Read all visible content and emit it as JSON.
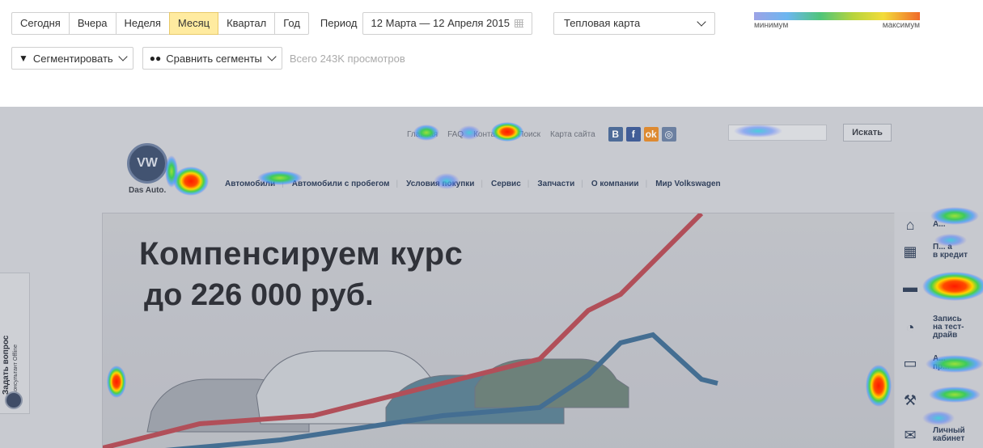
{
  "toolbar": {
    "periods": [
      "Сегодня",
      "Вчера",
      "Неделя",
      "Месяц",
      "Квартал",
      "Год"
    ],
    "active_period": "Месяц",
    "period_label": "Период",
    "date_range": "12 Марта — 12 Апреля 2015",
    "map_type": "Тепловая карта",
    "legend": {
      "min_label": "минимум",
      "max_label": "максимум"
    },
    "segment_label": "Сегментировать",
    "compare_label": "Сравнить сегменты",
    "views_total": "Всего 243K просмотров"
  },
  "site": {
    "top_links": [
      "Главная",
      "FAQ",
      "Контакты",
      "Поиск",
      "Карта сайта"
    ],
    "social": [
      {
        "glyph": "В",
        "color": "#4a6a9a"
      },
      {
        "glyph": "f",
        "color": "#3c5a98"
      },
      {
        "glyph": "ok",
        "color": "#e78a2a"
      },
      {
        "glyph": "◎",
        "color": "#6b7fa3"
      }
    ],
    "search_button": "Искать",
    "brand_caption": "Das Auto.",
    "nav": [
      "Автомобили",
      "Автомобили с пробегом",
      "Условия покупки",
      "Сервис",
      "Запчасти",
      "О компании",
      "Мир Volkswagen"
    ],
    "headline": "Компенсируем курс",
    "subline": "до 226 000 руб.",
    "side_tab": {
      "title": "Задать вопрос",
      "subtitle": "Консультант Offline"
    },
    "right_menu": [
      {
        "icon": "home-icon",
        "glyph": "⌂",
        "label": "А..."
      },
      {
        "icon": "calculator-icon",
        "glyph": "▦",
        "label": "П... а\nв кредит"
      },
      {
        "icon": "car-icon",
        "glyph": "▬",
        "label": ""
      },
      {
        "icon": "speedometer-icon",
        "glyph": "◔",
        "label": "Запись\nна тест-драйв"
      },
      {
        "icon": "car-outline-icon",
        "glyph": "▭",
        "label": "А...\nпр..."
      },
      {
        "icon": "tools-icon",
        "glyph": "⚒",
        "label": ""
      },
      {
        "icon": "cabinet-icon",
        "glyph": "✉",
        "label": "Личный\nкабинет"
      }
    ]
  }
}
